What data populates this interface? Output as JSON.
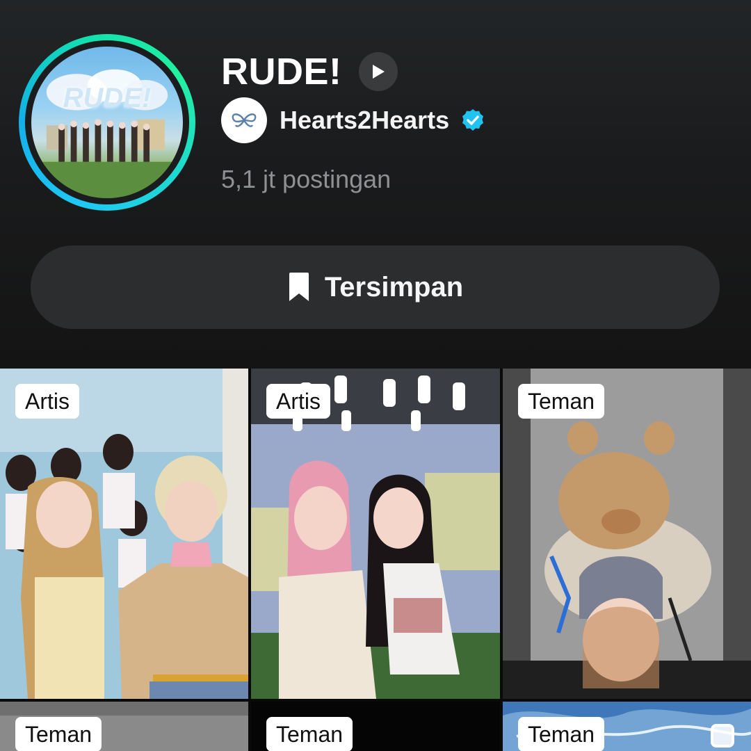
{
  "playlist": {
    "title": "RUDE!",
    "artist": "Hearts2Hearts",
    "post_count": "5,1 jt postingan",
    "saved_label": "Tersimpan",
    "cover_text": "RUDE!"
  },
  "icons": {
    "play": "play-icon",
    "verified": "verified-badge-icon",
    "bookmark": "bookmark-icon",
    "artist_logo": "hearts2hearts-logo-icon",
    "select": "checkbox-icon"
  },
  "colors": {
    "ring_start": "#1fc8f5",
    "ring_end": "#22f0a0",
    "verified": "#20c3ef",
    "button_bg": "#2c2d2f"
  },
  "grid": [
    {
      "tag": "Artis"
    },
    {
      "tag": "Artis"
    },
    {
      "tag": "Teman"
    },
    {
      "tag": "Teman"
    },
    {
      "tag": "Teman"
    },
    {
      "tag": "Teman"
    }
  ]
}
